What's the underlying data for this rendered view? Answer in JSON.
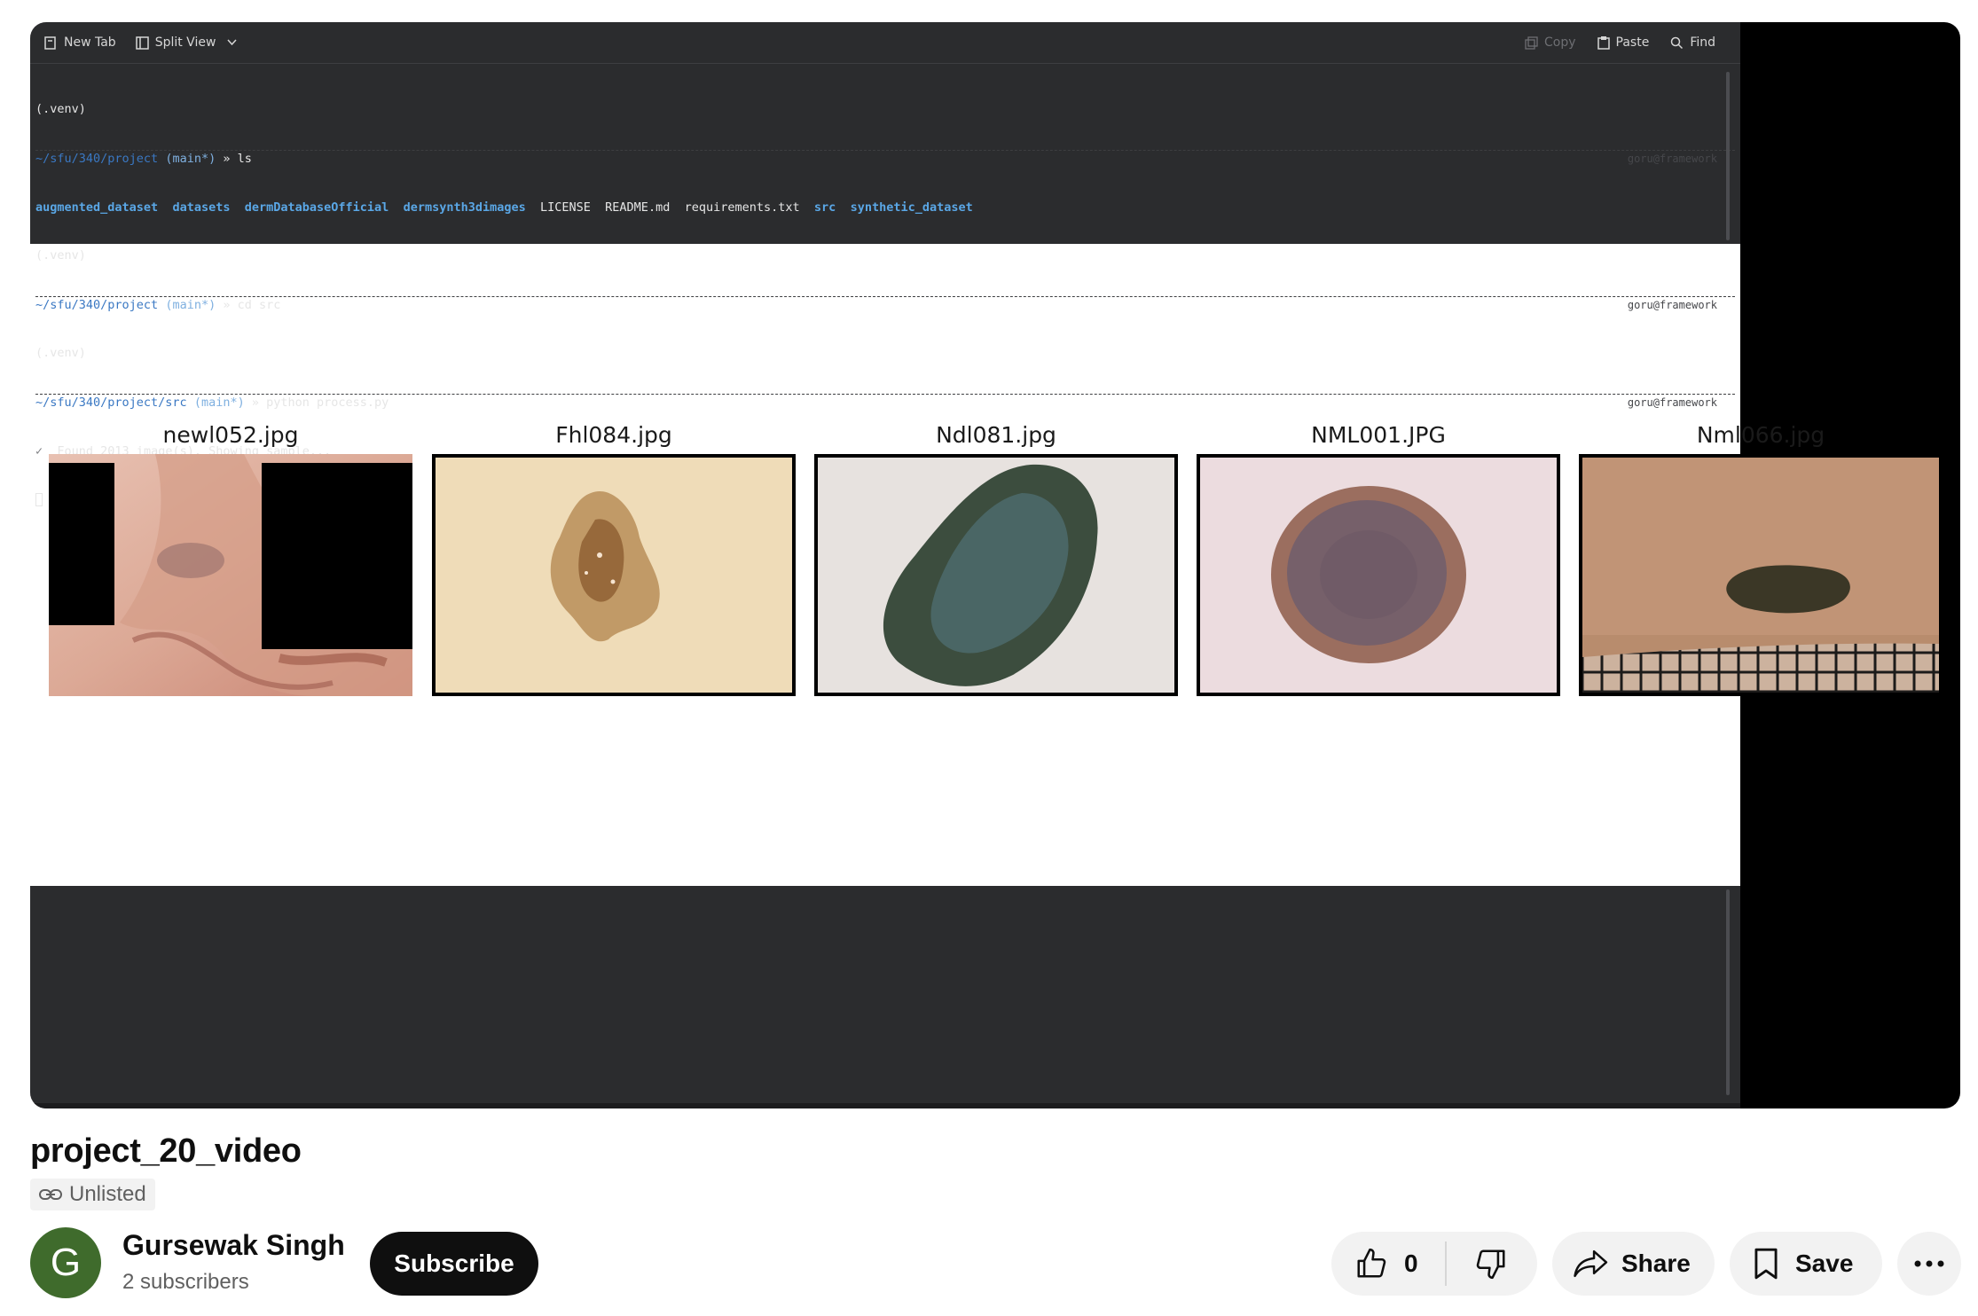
{
  "terminal": {
    "toolbar": {
      "new_tab": "New Tab",
      "split_view": "Split View",
      "copy": "Copy",
      "paste": "Paste",
      "find": "Find"
    },
    "host": "goru@framework",
    "lines": {
      "venv1": "(.venv)",
      "prompt1_path": "~/sfu/340/project",
      "prompt1_branch": "(main*)",
      "prompt1_cmd": " » ls",
      "ls": [
        "augmented_dataset",
        "datasets",
        "dermDatabaseOfficial",
        "dermsynth3dimages",
        "LICENSE",
        "README.md",
        "requirements.txt",
        "src",
        "synthetic_dataset"
      ],
      "venv2": "(.venv)",
      "prompt2_path": "~/sfu/340/project",
      "prompt2_branch": "(main*)",
      "prompt2_cmd": " » cd src",
      "venv3": "(.venv)",
      "prompt3_path": "~/sfu/340/project/src",
      "prompt3_branch": "(main*)",
      "prompt3_cmd": " » python process.py",
      "check": "✓",
      "output": "Found 2013 image(s). Showing sample..."
    }
  },
  "images": [
    {
      "title": "newl052.jpg",
      "content": "face-nose-lesion"
    },
    {
      "title": "Fhl084.jpg",
      "content": "brown-lesion"
    },
    {
      "title": "Ndl081.jpg",
      "content": "dark-blue-lesion"
    },
    {
      "title": "NML001.JPG",
      "content": "round-brown-mole"
    },
    {
      "title": "Nml066.jpg",
      "content": "small-lesion-with-grid"
    }
  ],
  "video": {
    "title": "project_20_video",
    "visibility": "Unlisted"
  },
  "channel": {
    "avatar_letter": "G",
    "avatar_color": "#3f6b2c",
    "name": "Gursewak Singh",
    "subscribers": "2 subscribers",
    "subscribe_label": "Subscribe"
  },
  "actions": {
    "like_count": "0",
    "share_label": "Share",
    "save_label": "Save"
  }
}
